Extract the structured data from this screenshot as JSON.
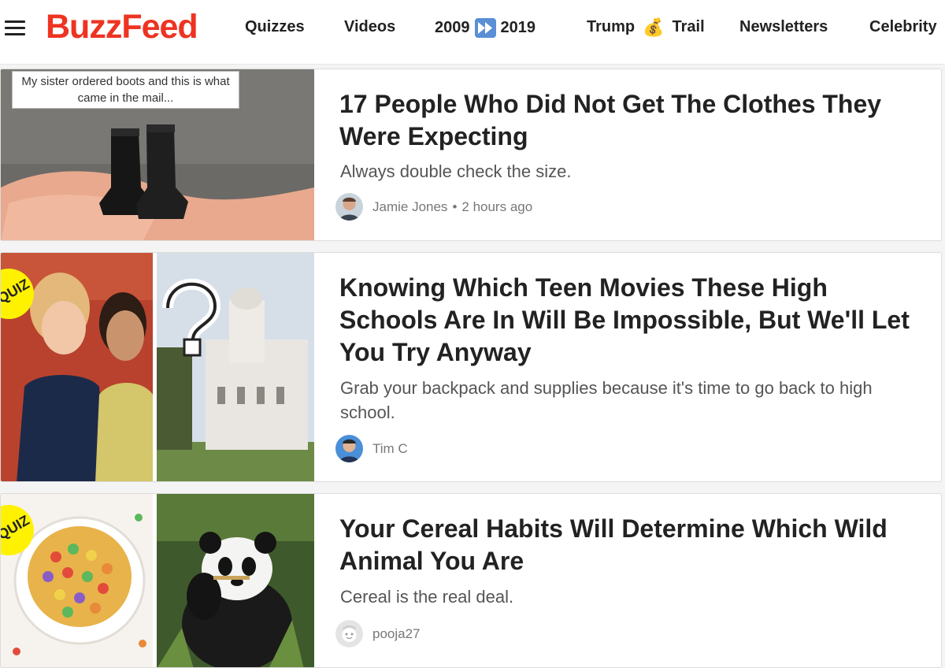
{
  "header": {
    "logo": "BuzzFeed",
    "nav": {
      "quizzes": "Quizzes",
      "videos": "Videos",
      "year_start": "2009",
      "year_end": "2019",
      "trump": "Trump",
      "trail": "Trail",
      "newsletters": "Newsletters",
      "celebrity": "Celebrity"
    }
  },
  "articles": [
    {
      "title": "17 People Who Did Not Get The Clothes They Were Expecting",
      "description": "Always double check the size.",
      "author": "Jamie Jones",
      "time": "2 hours ago",
      "thumb_caption": "My sister ordered boots and this is what came in the mail..."
    },
    {
      "title": "Knowing Which Teen Movies These High Schools Are In Will Be Impossible, But We'll Let You Try Anyway",
      "description": "Grab your backpack and supplies because it's time to go back to high school.",
      "author": "Tim C",
      "badge": "QUIZ"
    },
    {
      "title": "Your Cereal Habits Will Determine Which Wild Animal You Are",
      "description": "Cereal is the real deal.",
      "author": "pooja27",
      "badge": "QUIZ"
    }
  ],
  "colors": {
    "brand": "#ee3322",
    "quiz_badge": "#fff200",
    "ff_icon": "#5a8fd6"
  },
  "icons": {
    "menu": "hamburger-menu-icon",
    "fast_forward": "fast-forward-icon",
    "money_bag": "money-bag-icon"
  }
}
